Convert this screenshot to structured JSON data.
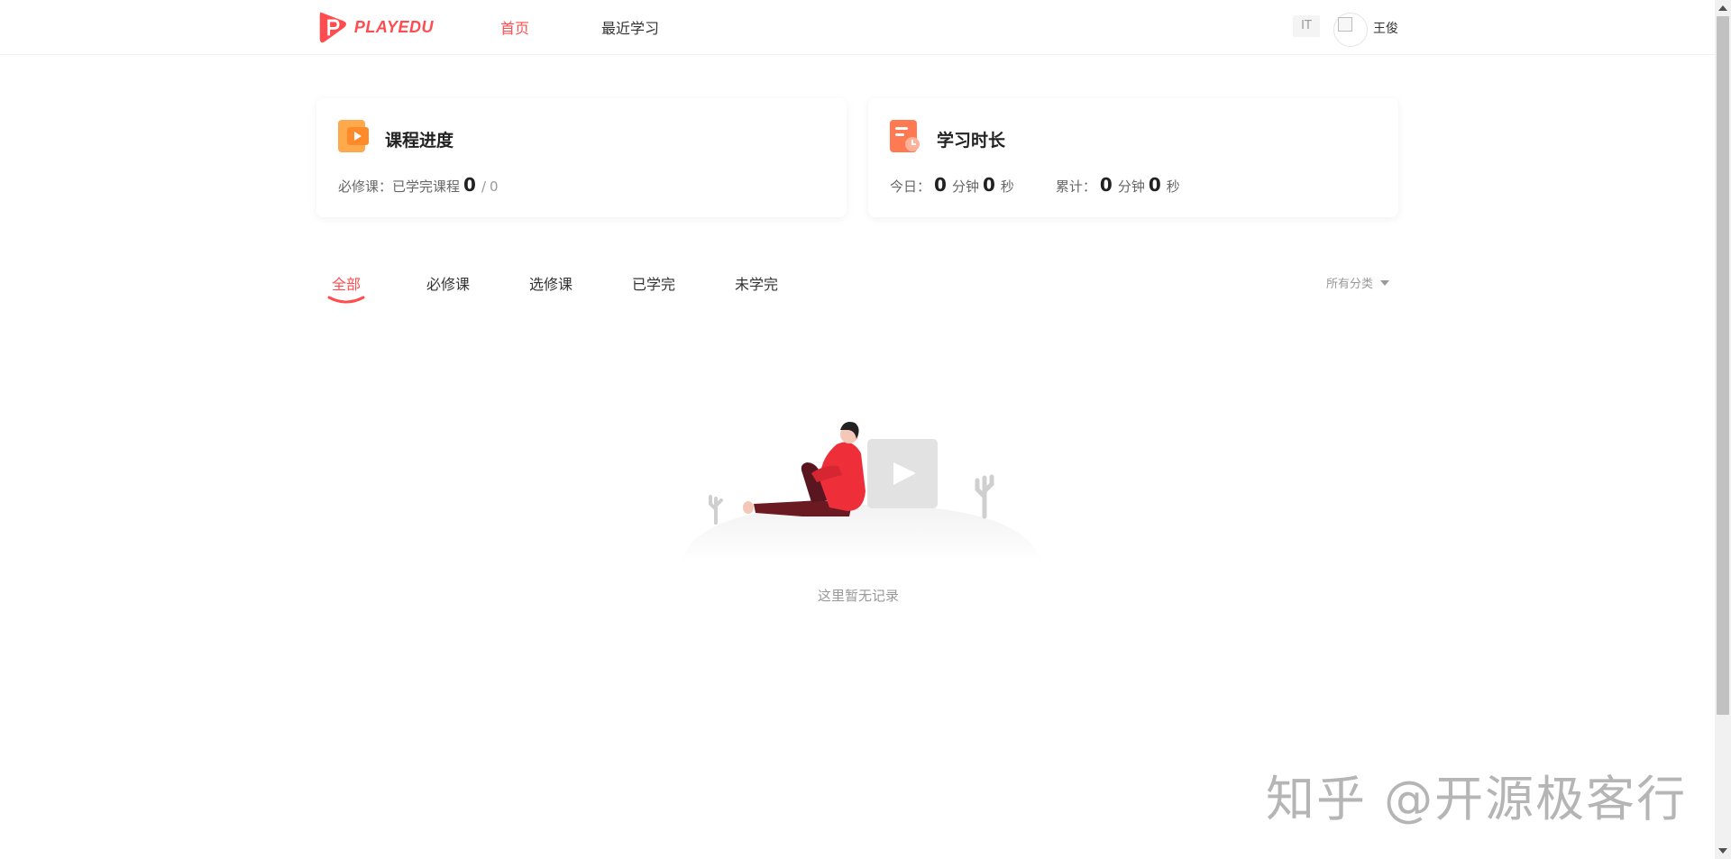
{
  "header": {
    "logo_text": "PLAYEDU",
    "nav": {
      "home": "首页",
      "recent": "最近学习"
    },
    "department_badge": "IT",
    "username": "王俊"
  },
  "cards": {
    "progress": {
      "icon": "course-progress-icon",
      "title": "课程进度",
      "required_label": "必修课：已学完课程",
      "completed": "0",
      "separator": "/",
      "total": "0"
    },
    "study_time": {
      "icon": "study-time-icon",
      "title": "学习时长",
      "today_label": "今日：",
      "today_minutes": "0",
      "today_seconds": "0",
      "total_label": "累计：",
      "total_minutes": "0",
      "total_seconds": "0",
      "minute_unit": "分钟",
      "second_unit": "秒"
    }
  },
  "tabs": {
    "items": [
      "全部",
      "必修课",
      "选修课",
      "已学完",
      "未学完"
    ],
    "active": "全部",
    "category_select": "所有分类"
  },
  "empty_state": {
    "text": "这里暂无记录"
  },
  "watermark": "知乎 @开源极客行",
  "colors": {
    "accent": "#ff4d4f",
    "progress_icon": "#ff9a3d",
    "time_icon": "#ff6b4a"
  }
}
